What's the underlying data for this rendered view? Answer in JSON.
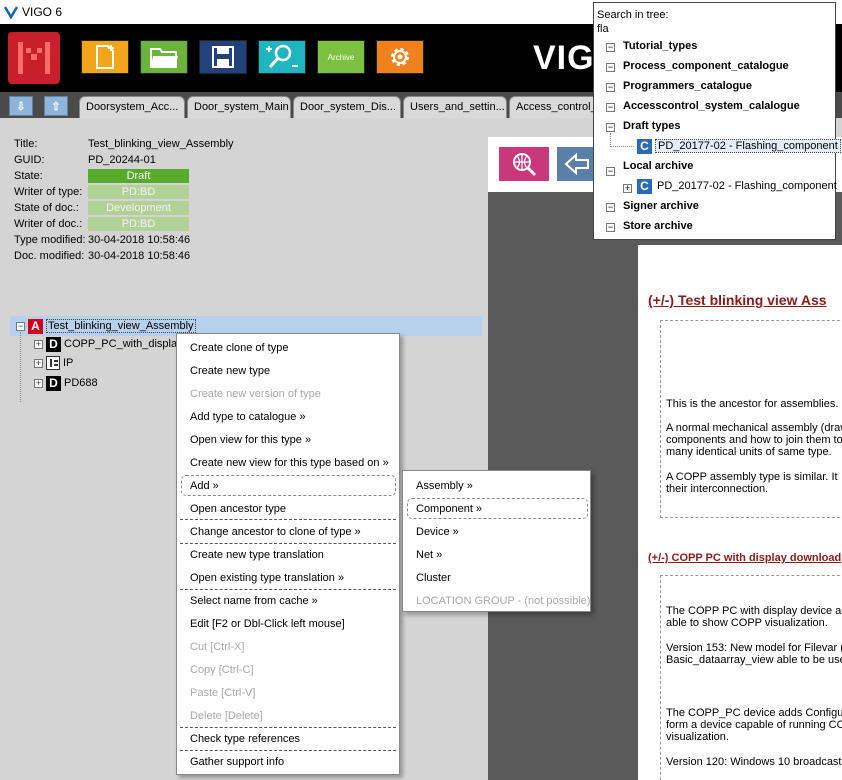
{
  "window": {
    "title": "VIGO 6"
  },
  "toolbar": {
    "archive_label": "Archive",
    "brand_text": "VIG"
  },
  "tabs": [
    "Doorsystem_Acc...",
    "Door_system_Main",
    "Door_system_Dis...",
    "Users_and_settin...",
    "Access_control_"
  ],
  "properties": {
    "title_label": "Title:",
    "title_value": "Test_blinking_view_Assembly",
    "guid_label": "GUID:",
    "guid_value": "PD_20244-01",
    "state_label": "State:",
    "state_value": "Draft",
    "writer_type_label": "Writer of type:",
    "writer_type_value": "PD:BD",
    "state_doc_label": "State of doc.:",
    "state_doc_value": "Development",
    "writer_doc_label": "Writer of doc.:",
    "writer_doc_value": "PD:BD",
    "type_modified_label": "Type modified:",
    "type_modified_value": "30-04-2018 10:58:46",
    "doc_modified_label": "Doc. modified:",
    "doc_modified_value": "30-04-2018 10:58:46"
  },
  "tree": {
    "root": {
      "badge": "A",
      "label": "Test_blinking_view_Assembly"
    },
    "children": [
      {
        "badge": "D",
        "label": "COPP_PC_with_display"
      },
      {
        "badge": "net",
        "label": "IP"
      },
      {
        "badge": "D",
        "label": "PD688"
      }
    ]
  },
  "context_menu": {
    "items": [
      {
        "label": "Create clone of type",
        "disabled": false
      },
      {
        "label": "Create new type",
        "disabled": false
      },
      {
        "label": "Create new version of type",
        "disabled": true
      },
      {
        "label": "Add type to catalogue »",
        "disabled": false
      },
      {
        "label": "Open view for this type »",
        "disabled": false
      },
      {
        "label": "Create new view for this type based on »",
        "disabled": false
      },
      {
        "label": "Add »",
        "disabled": false
      },
      {
        "label": "Open ancestor type",
        "disabled": false
      },
      {
        "label": "Change ancestor to clone of type »",
        "disabled": false
      },
      {
        "label": "Create new type translation",
        "disabled": false
      },
      {
        "label": "Open existing type translation »",
        "disabled": false
      },
      {
        "label": "Select name from cache »",
        "disabled": false
      },
      {
        "label": "Edit [F2 or Dbl-Click left mouse]",
        "disabled": false
      },
      {
        "label": "Cut [Ctrl-X]",
        "disabled": true
      },
      {
        "label": "Copy [Ctrl-C]",
        "disabled": true
      },
      {
        "label": "Paste [Ctrl-V]",
        "disabled": true
      },
      {
        "label": "Delete [Delete]",
        "disabled": true
      },
      {
        "label": "Check type references",
        "disabled": false
      },
      {
        "label": "Gather support info",
        "disabled": false
      }
    ]
  },
  "submenu": {
    "items": [
      {
        "label": "Assembly »",
        "disabled": false
      },
      {
        "label": "Component »",
        "disabled": false
      },
      {
        "label": "Device »",
        "disabled": false
      },
      {
        "label": "Net »",
        "disabled": false
      },
      {
        "label": "Cluster",
        "disabled": false
      },
      {
        "label": "LOCATION GROUP - (not possible)",
        "disabled": true
      }
    ]
  },
  "search": {
    "label": "Search in tree:",
    "query": "fla",
    "groups": [
      {
        "label": "Tutorial_types"
      },
      {
        "label": "Process_component_catalogue"
      },
      {
        "label": "Programmers_catalogue"
      },
      {
        "label": "Accesscontrol_system_calalogue"
      },
      {
        "label": "Draft types"
      },
      {
        "label": "Local archive"
      },
      {
        "label": "Signer archive"
      },
      {
        "label": "Store archive"
      }
    ],
    "draft_child": "PD_20177-02 - Flashing_component",
    "archive_child": "PD_20177-02 - Flashing_component"
  },
  "document": {
    "heading1": "(+/-) Test blinking view Ass",
    "p1": "This is the ancestor for assemblies.",
    "p2a": "A normal mechanical assembly (draw",
    "p2b": "components and how to join them to",
    "p2c": "many identical units of same type.",
    "p3a": "A COPP assembly type is similar. It",
    "p3b": "their interconnection.",
    "heading2": "(+/-) COPP PC with display download",
    "p4a": "The COPP PC with display device ac",
    "p4b": "able to show COPP visualization.",
    "p5a": "Version 153: New model for Filevar (",
    "p5b": "Basic_dataarray_view able to be use",
    "p6a": "The COPP_PC device adds Configu",
    "p6b": "form a device capable of running CO",
    "p6c": "visualization.",
    "p7": "Version 120: Windows 10 broadcast"
  }
}
